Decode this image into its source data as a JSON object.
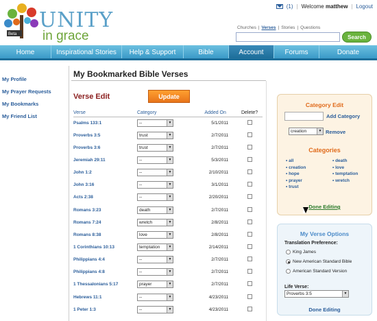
{
  "logo": {
    "word1": "UNITY",
    "word2": "in grace",
    "badge": "Beta"
  },
  "user_bar": {
    "message_count": "(1)",
    "welcome_prefix": "Welcome",
    "username": "matthew",
    "logout": "Logout"
  },
  "search": {
    "tabs": [
      "Churches",
      "Verses",
      "Stories",
      "Questions"
    ],
    "active_tab": "Verses",
    "value": "",
    "button": "Search"
  },
  "nav": [
    "Home",
    "Inspirational Stories",
    "Help & Support",
    "Bible",
    "Account",
    "Forums",
    "Donate"
  ],
  "sidebar": [
    "My Profile",
    "My Prayer Requests",
    "My Bookmarks",
    "My Friend List"
  ],
  "page_title": "My Bookmarked Bible Verses",
  "verse_edit": {
    "heading": "Verse Edit",
    "update_button": "Update"
  },
  "table": {
    "headers": [
      "Verse",
      "Category",
      "Added On",
      "Delete?"
    ],
    "rows": [
      {
        "verse": "Psalms 133:1",
        "category": "--",
        "date": "5/1/2011"
      },
      {
        "verse": "Proverbs 3:5",
        "category": "trust",
        "date": "2/7/2011"
      },
      {
        "verse": "Proverbs 3:6",
        "category": "trust",
        "date": "2/7/2011"
      },
      {
        "verse": "Jeremiah 29:11",
        "category": "--",
        "date": "5/3/2011"
      },
      {
        "verse": "John 1:2",
        "category": "--",
        "date": "2/10/2011"
      },
      {
        "verse": "John 3:16",
        "category": "--",
        "date": "3/1/2011"
      },
      {
        "verse": "Acts 2:38",
        "category": "--",
        "date": "2/20/2011"
      },
      {
        "verse": "Romans 3:23",
        "category": "death",
        "date": "2/7/2011"
      },
      {
        "verse": "Romans 7:24",
        "category": "wretch",
        "date": "2/8/2011"
      },
      {
        "verse": "Romans 8:38",
        "category": "love",
        "date": "2/8/2011"
      },
      {
        "verse": "1 Corinthians 10:13",
        "category": "temptation",
        "date": "2/14/2011"
      },
      {
        "verse": "Philippians 4:4",
        "category": "--",
        "date": "2/7/2011"
      },
      {
        "verse": "Philippians 4:8",
        "category": "--",
        "date": "2/7/2011"
      },
      {
        "verse": "1 Thessalonians 5:17",
        "category": "prayer",
        "date": "2/7/2011"
      },
      {
        "verse": "Hebrews 11:1",
        "category": "--",
        "date": "4/23/2011"
      },
      {
        "verse": "1 Peter 1:3",
        "category": "--",
        "date": "4/23/2011"
      }
    ]
  },
  "category_edit": {
    "title": "Category Edit",
    "add_label": "Add Category",
    "selected": "creation",
    "remove_label": "Remove",
    "categories_title": "Categories",
    "col1": [
      "all",
      "creation",
      "hope",
      "prayer",
      "trust"
    ],
    "col2": [
      "death",
      "love",
      "temptation",
      "wretch"
    ],
    "done": "Done Editing"
  },
  "verse_options": {
    "title": "My Verse Options",
    "translation_label": "Translation Preference:",
    "options": [
      "King James",
      "New American Standard Bible",
      "American Standard Version"
    ],
    "selected_index": 1,
    "life_verse_label": "Life Verse:",
    "life_verse_value": "Proverbs 3:5",
    "done": "Done Editing"
  }
}
